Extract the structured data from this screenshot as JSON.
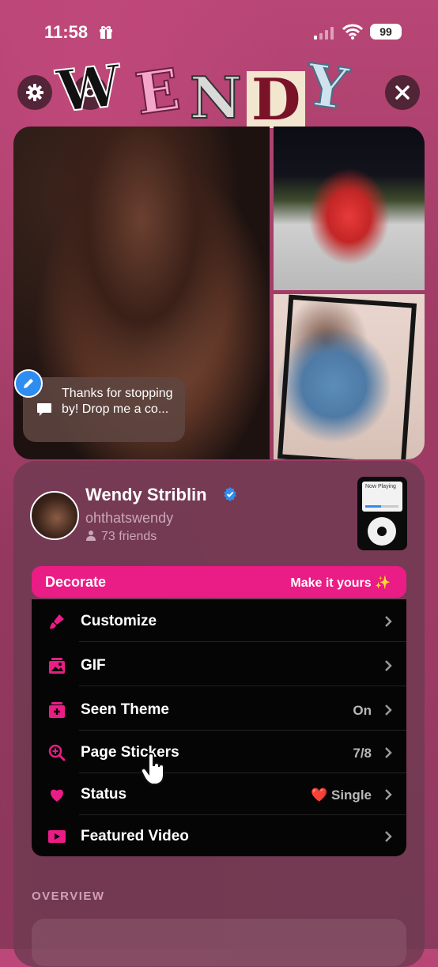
{
  "status_bar": {
    "time": "11:58",
    "battery": "99"
  },
  "header": {
    "title_letters": [
      "W",
      "E",
      "N",
      "D",
      "Y"
    ]
  },
  "photos": {
    "greeting": "Thanks for stopping by! Drop me a co..."
  },
  "profile": {
    "name": "Wendy Striblin",
    "handle": "ohthatswendy",
    "friends": "73 friends",
    "widget_label": "Now Playing"
  },
  "decorate": {
    "label": "Decorate",
    "cta": "Make it yours ✨"
  },
  "menu": [
    {
      "label": "Customize",
      "value": ""
    },
    {
      "label": "GIF",
      "value": ""
    },
    {
      "label": "Seen Theme",
      "value": "On"
    },
    {
      "label": "Page Stickers",
      "value": "7/8"
    },
    {
      "label": "Status",
      "value": "❤️ Single"
    },
    {
      "label": "Featured Video",
      "value": ""
    }
  ],
  "overview": {
    "heading": "OVERVIEW"
  },
  "colors": {
    "accent": "#ea1c85",
    "verified": "#2f8cf0"
  }
}
